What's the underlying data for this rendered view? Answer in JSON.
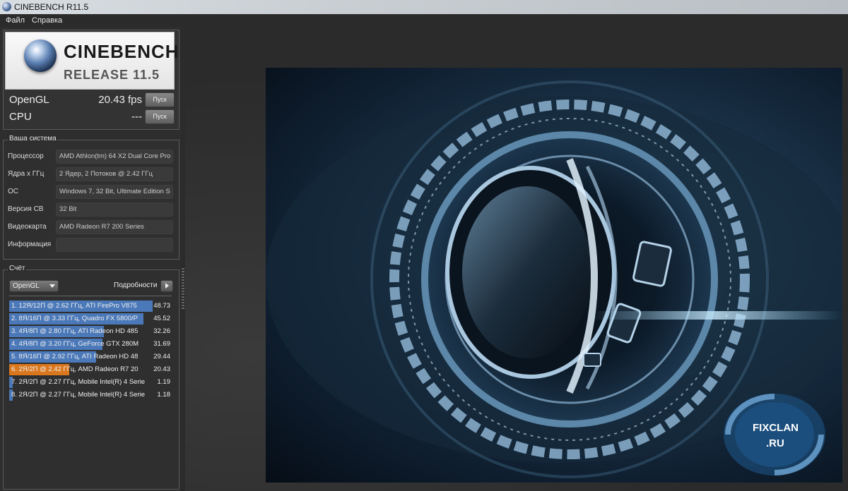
{
  "window": {
    "title": "CINEBENCH R11.5"
  },
  "menu": {
    "items": [
      "Файл",
      "Справка"
    ]
  },
  "logo": {
    "title": "CINEBENCH",
    "subtitle": "RELEASE 11.5"
  },
  "benchmarks": {
    "opengl": {
      "label": "OpenGL",
      "value": "20.43 fps",
      "button": "Пуск"
    },
    "cpu": {
      "label": "CPU",
      "value": "---",
      "button": "Пуск"
    }
  },
  "system": {
    "title": "Ваша система",
    "rows": [
      {
        "label": "Процессор",
        "value": "AMD Athlon(tm) 64 X2 Dual Core Pro"
      },
      {
        "label": "Ядра x ГГц",
        "value": "2 Ядер, 2 Потоков @ 2.42 ГГц"
      },
      {
        "label": "ОС",
        "value": "Windows 7, 32 Bit, Ultimate Edition S"
      },
      {
        "label": "Версия CB",
        "value": "32 Bit"
      },
      {
        "label": "Видеокарта",
        "value": "AMD Radeon R7 200 Series"
      },
      {
        "label": "Информация",
        "value": ""
      }
    ]
  },
  "ranking": {
    "title": "Счёт",
    "selected_mode": "OpenGL",
    "details_label": "Подробности",
    "items": [
      {
        "text": "1. 12Я/12П @ 2.62 ГГц, ATI FirePro V875",
        "score": "48.73",
        "fraction": 1.0,
        "highlight": false
      },
      {
        "text": "2. 8Я/16П @ 3.33 ГГц, Quadro FX 5800/P",
        "score": "45.52",
        "fraction": 0.934,
        "highlight": false
      },
      {
        "text": "3. 4Я/8П @ 2.80 ГГц, ATI Radeon HD 485",
        "score": "32.26",
        "fraction": 0.662,
        "highlight": false
      },
      {
        "text": "4. 4Я/8П @ 3.20 ГГц, GeForce GTX 280M",
        "score": "31.69",
        "fraction": 0.65,
        "highlight": false
      },
      {
        "text": "5. 8Я/16П @ 2.92 ГГц, ATI Radeon HD 48",
        "score": "29.44",
        "fraction": 0.604,
        "highlight": false
      },
      {
        "text": "6. 2Я/2П @ 2.42 ГГц, AMD Radeon R7 20",
        "score": "20.43",
        "fraction": 0.419,
        "highlight": true
      },
      {
        "text": "7. 2Я/2П @ 2.27 ГГц, Mobile Intel(R) 4 Serie",
        "score": "1.19",
        "fraction": 0.024,
        "highlight": false
      },
      {
        "text": "8. 2Я/2П @ 2.27 ГГц, Mobile Intel(R) 4 Serie",
        "score": "1.18",
        "fraction": 0.024,
        "highlight": false
      }
    ]
  },
  "colors": {
    "bar_blue": "#4a78b8",
    "bar_orange": "#d9771e"
  },
  "watermark": {
    "line1": "FIXCLAN",
    "line2": ".RU"
  }
}
